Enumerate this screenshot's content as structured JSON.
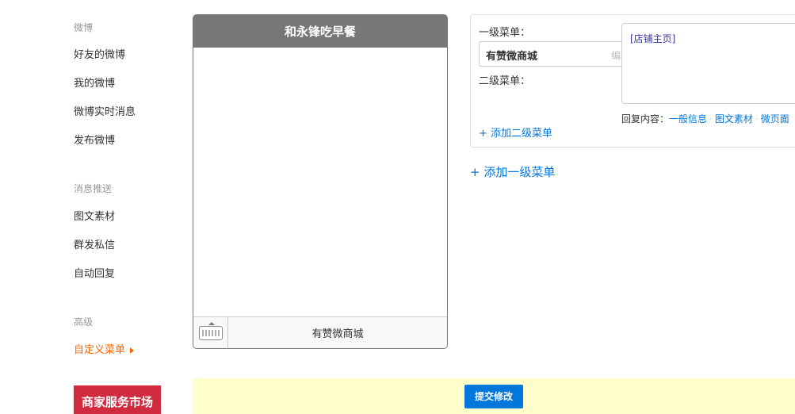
{
  "sidebar": {
    "sections": [
      {
        "title": "微博",
        "items": [
          "好友的微博",
          "我的微博",
          "微博实时消息",
          "发布微博"
        ]
      },
      {
        "title": "消息推送",
        "items": [
          "图文素材",
          "群发私信",
          "自动回复"
        ]
      },
      {
        "title": "高级",
        "items": [
          "自定义菜单"
        ]
      }
    ],
    "banner": "商家服务市场"
  },
  "phone": {
    "title": "和永锋吃早餐",
    "footer_menu": "有赞微商城",
    "keyboard_icon": "keyboard-icon"
  },
  "editor": {
    "level1_label": "一级菜单：",
    "level1_name": "有赞微商城",
    "edit_label": "编辑",
    "level2_label": "二级菜单：",
    "reply_content": "[店铺主页]",
    "reply_prefix": "回复内容：",
    "reply_options": [
      "一般信息",
      "图文素材",
      "微页面"
    ],
    "add_sub": "+ 添加二级菜单"
  },
  "add_top": "+ 添加一级菜单",
  "submit": {
    "label": "提交修改"
  },
  "colors": {
    "accent": "#0077dd",
    "active": "#ff6600",
    "banner": "#d12b3f",
    "submit_bar": "#ffffcc"
  }
}
